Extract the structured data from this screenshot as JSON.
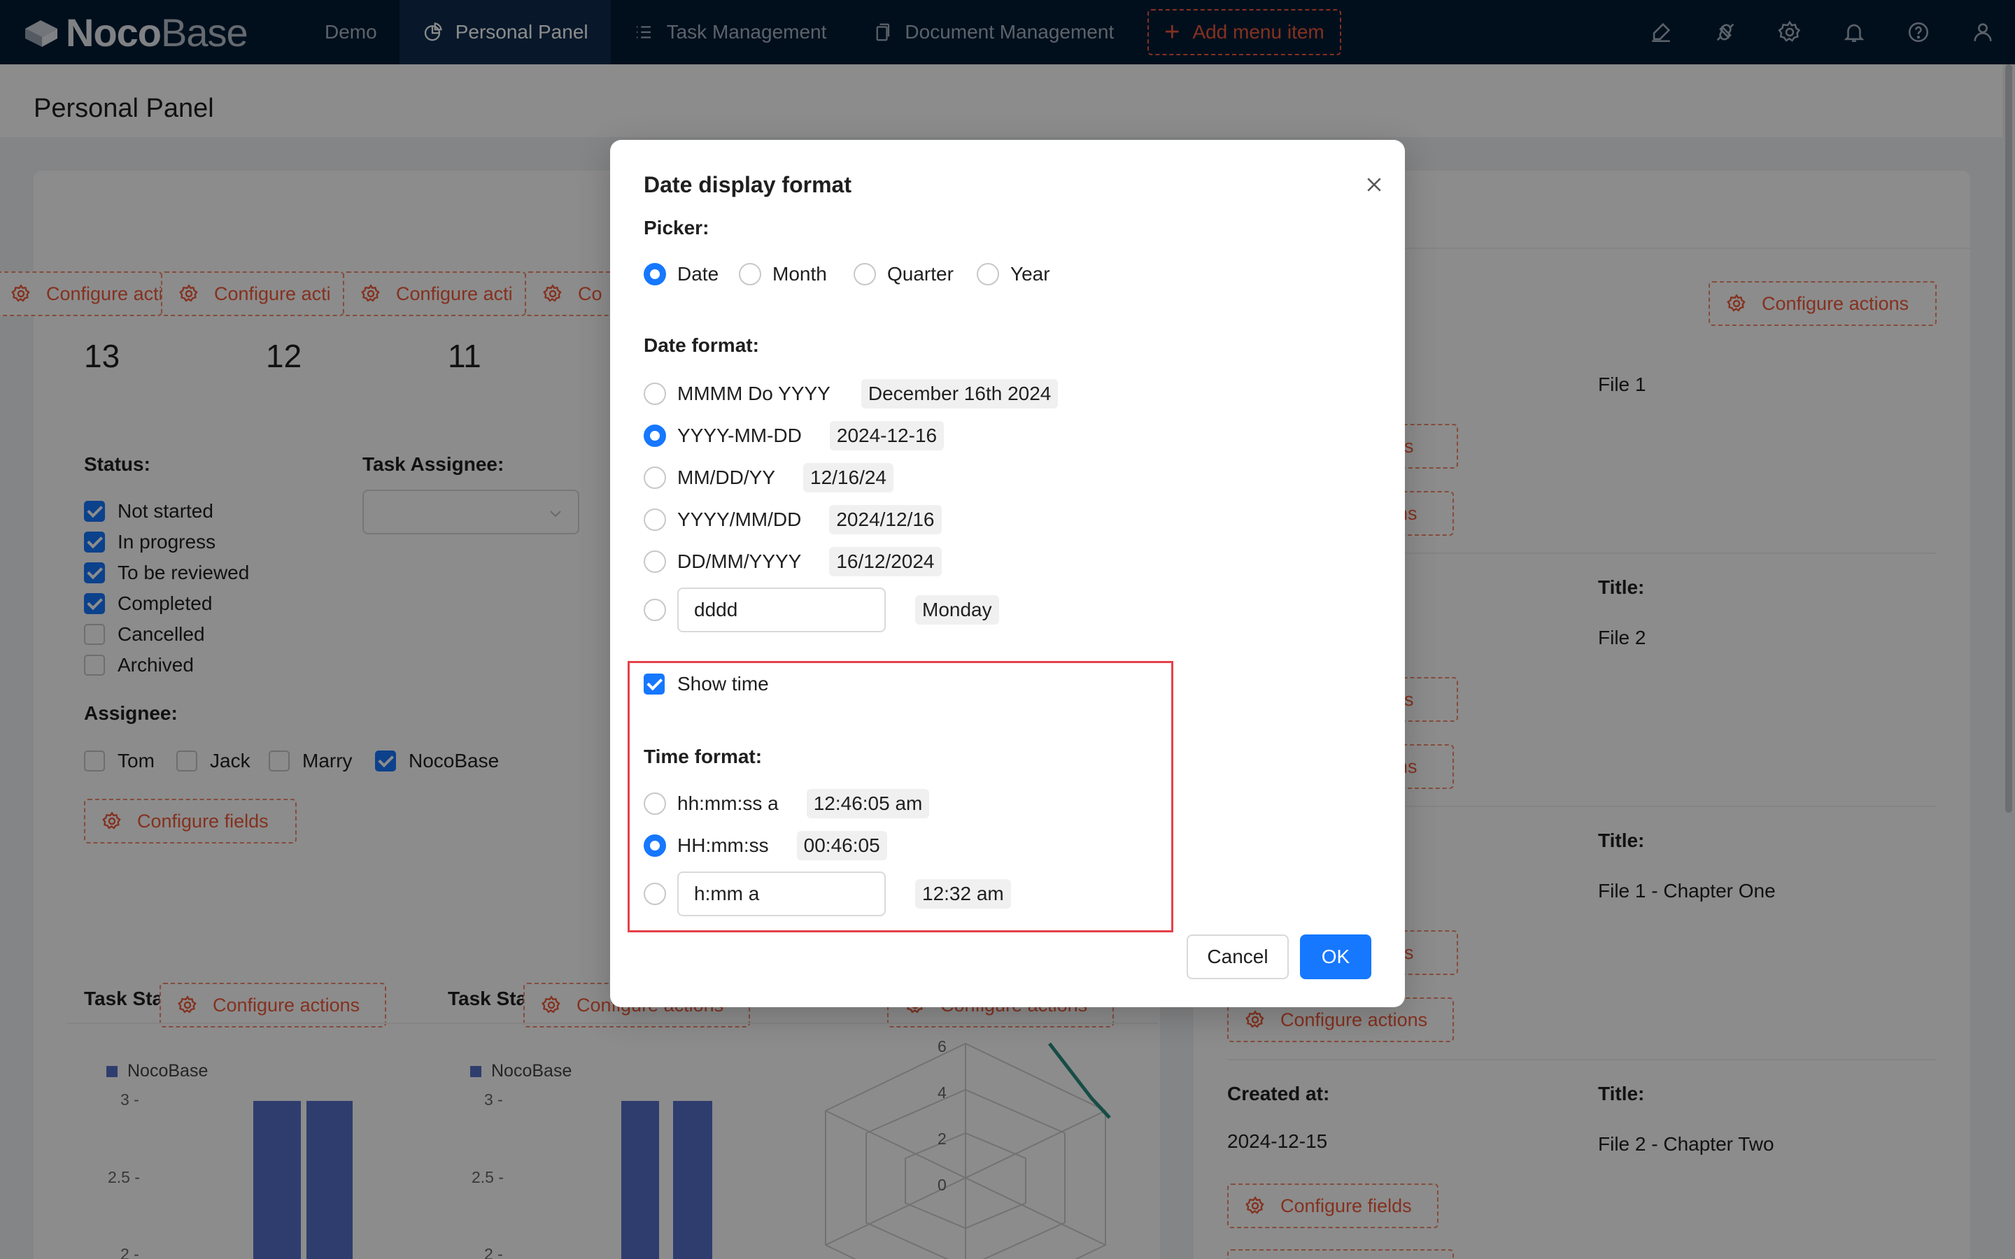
{
  "app": {
    "logo_bold": "Noco",
    "logo_thin": "Base",
    "nav": [
      {
        "label": "Demo",
        "icon": "none",
        "active": false
      },
      {
        "label": "Personal Panel",
        "icon": "pie-chart-icon",
        "active": true
      },
      {
        "label": "Task Management",
        "icon": "list-icon",
        "active": false
      },
      {
        "label": "Document Management",
        "icon": "copy-icon",
        "active": false
      }
    ],
    "add_menu_label": "Add menu item",
    "top_icons": [
      "theme-brush-icon",
      "plugin-icon",
      "settings-icon",
      "bell-icon",
      "help-icon",
      "user-icon"
    ]
  },
  "page": {
    "title": "Personal Panel",
    "configure_actions": "Configure actions",
    "configure_actions_truncated": "Configure acti",
    "configure_actions_short": "Co",
    "configure_fields": "Configure fields",
    "stats": [
      "13",
      "12",
      "11"
    ],
    "status_label": "Status:",
    "assignee_filter_label": "Task Assignee:",
    "statuses": [
      {
        "label": "Not started",
        "checked": true
      },
      {
        "label": "In progress",
        "checked": true
      },
      {
        "label": "To be reviewed",
        "checked": true
      },
      {
        "label": "Completed",
        "checked": true
      },
      {
        "label": "Cancelled",
        "checked": false
      },
      {
        "label": "Archived",
        "checked": false
      }
    ],
    "assignee_label": "Assignee:",
    "assignees": [
      {
        "label": "Tom",
        "checked": false
      },
      {
        "label": "Jack",
        "checked": false
      },
      {
        "label": "Marry",
        "checked": false
      },
      {
        "label": "NocoBase",
        "checked": true
      }
    ],
    "chart_title_1": "Task Stat",
    "chart_title_2": "Task Stat",
    "legend_series": "NocoBase",
    "y_ticks": [
      "3 -",
      "2.5 -",
      "2 -"
    ],
    "radar_ticks": [
      "6",
      "4",
      "2",
      "0"
    ],
    "right_panel": {
      "file_1": "File 1",
      "title_label": "Title:",
      "file_2": "File 2",
      "file_3": "File 1 - Chapter One",
      "created_at_label": "Created at:",
      "created_at_value": "2024-12-15",
      "file_4": "File 2 - Chapter Two",
      "ds_partial": "ds",
      "ons_partial": "ons"
    },
    "accent_color": "#f05a3a",
    "bar_color": "#5470c6"
  },
  "chart_data": [
    {
      "type": "bar",
      "title": "",
      "series": [
        {
          "name": "NocoBase",
          "values": [
            3,
            3
          ]
        }
      ],
      "ylim_visible": [
        2,
        3
      ]
    },
    {
      "type": "bar",
      "title": "",
      "series": [
        {
          "name": "NocoBase",
          "values": [
            3,
            3
          ]
        }
      ],
      "ylim_visible": [
        2,
        3
      ]
    }
  ],
  "modal": {
    "title": "Date display format",
    "picker_label": "Picker:",
    "picker_options": [
      {
        "label": "Date",
        "selected": true
      },
      {
        "label": "Month",
        "selected": false
      },
      {
        "label": "Quarter",
        "selected": false
      },
      {
        "label": "Year",
        "selected": false
      }
    ],
    "date_format_label": "Date format:",
    "date_formats": [
      {
        "format": "MMMM Do YYYY",
        "example": "December 16th 2024",
        "selected": false
      },
      {
        "format": "YYYY-MM-DD",
        "example": "2024-12-16",
        "selected": true
      },
      {
        "format": "MM/DD/YY",
        "example": "12/16/24",
        "selected": false
      },
      {
        "format": "YYYY/MM/DD",
        "example": "2024/12/16",
        "selected": false
      },
      {
        "format": "DD/MM/YYYY",
        "example": "16/12/2024",
        "selected": false
      }
    ],
    "custom_date_format": {
      "value": "dddd",
      "example": "Monday",
      "selected": false
    },
    "show_time_label": "Show time",
    "show_time_checked": true,
    "time_format_label": "Time format:",
    "time_formats": [
      {
        "format": "hh:mm:ss a",
        "example": "12:46:05 am",
        "selected": false
      },
      {
        "format": "HH:mm:ss",
        "example": "00:46:05",
        "selected": true
      }
    ],
    "custom_time_format": {
      "value": "h:mm a",
      "example": "12:32 am",
      "selected": false
    },
    "cancel_label": "Cancel",
    "ok_label": "OK",
    "primary_color": "#1677ff",
    "highlight_color": "#e4414b"
  }
}
